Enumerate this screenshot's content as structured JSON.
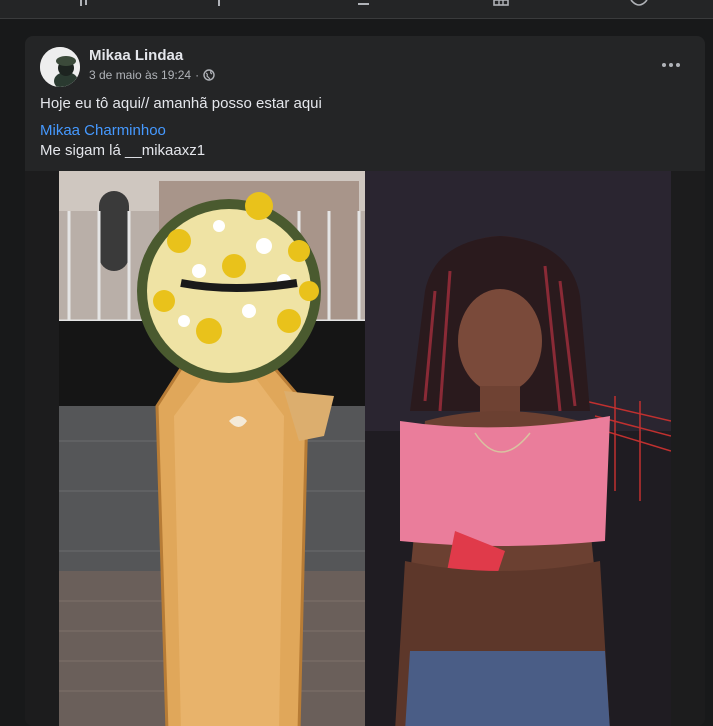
{
  "post": {
    "author": "Mikaa Lindaa",
    "timestamp": "3 de maio às 19:24",
    "separator": "·",
    "privacy_icon": "globe-icon",
    "menu_icon": "more-options-icon",
    "text_line1": "Hoje eu tô aqui// amanhã posso estar aqui",
    "mention": "Mikaa Charminhoo",
    "text_line2": "Me sigam lá __mikaaxz1"
  },
  "colors": {
    "background": "#18191a",
    "card": "#242526",
    "text_primary": "#e4e6eb",
    "text_secondary": "#b0b3b8",
    "link": "#4599ff"
  }
}
